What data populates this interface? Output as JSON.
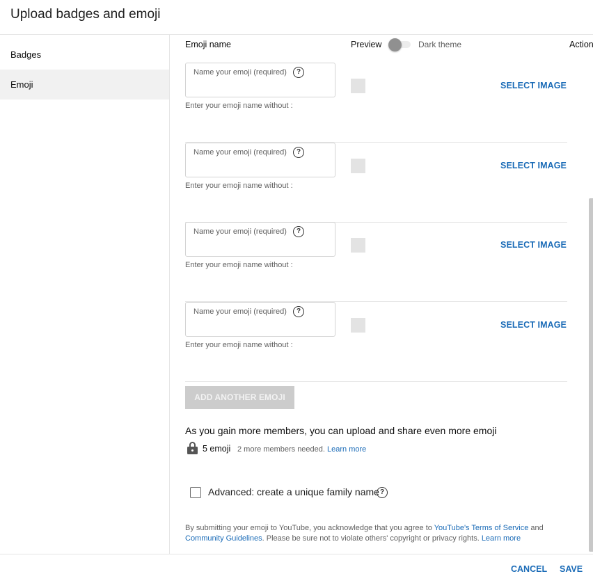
{
  "dialog": {
    "title": "Upload badges and emoji"
  },
  "sidebar": {
    "items": [
      {
        "label": "Badges",
        "selected": false
      },
      {
        "label": "Emoji",
        "selected": true
      }
    ]
  },
  "table_header": {
    "name": "Emoji name",
    "preview": "Preview",
    "dark_theme_label": "Dark theme",
    "dark_theme_on": false,
    "actions": "Actions"
  },
  "emoji_rows": [
    {
      "value": "",
      "placeholder": "Name your emoji (required)",
      "hint": "Enter your emoji name without :",
      "action": "SELECT IMAGE"
    },
    {
      "value": "",
      "placeholder": "Name your emoji (required)",
      "hint": "Enter your emoji name without :",
      "action": "SELECT IMAGE"
    },
    {
      "value": "",
      "placeholder": "Name your emoji (required)",
      "hint": "Enter your emoji name without :",
      "action": "SELECT IMAGE"
    },
    {
      "value": "",
      "placeholder": "Name your emoji (required)",
      "hint": "Enter your emoji name without :",
      "action": "SELECT IMAGE"
    }
  ],
  "add_button": {
    "label": "ADD ANOTHER EMOJI",
    "disabled": true
  },
  "members": {
    "gain_text": "As you gain more members, you can upload and share even more emoji",
    "lock_icon": "lock-icon",
    "emoji_count": "5 emoji",
    "needed_text": "2 more members needed.",
    "learn_more": "Learn more"
  },
  "advanced": {
    "label": "Advanced: create a unique family name",
    "checked": false
  },
  "legal": {
    "prefix": "By submitting your emoji to YouTube, you acknowledge that you agree to ",
    "tos_link": "YouTube's Terms of Service",
    "and": " and ",
    "guidelines_link": "Community Guidelines",
    "middle": ". Please be sure not to violate others' copyright or privacy rights. ",
    "learn_more": "Learn more"
  },
  "footer": {
    "cancel": "CANCEL",
    "save": "SAVE"
  },
  "colors": {
    "link": "#1a6bb7",
    "selected_bg": "#f1f1f1",
    "disabled_button": "#cccccc"
  }
}
